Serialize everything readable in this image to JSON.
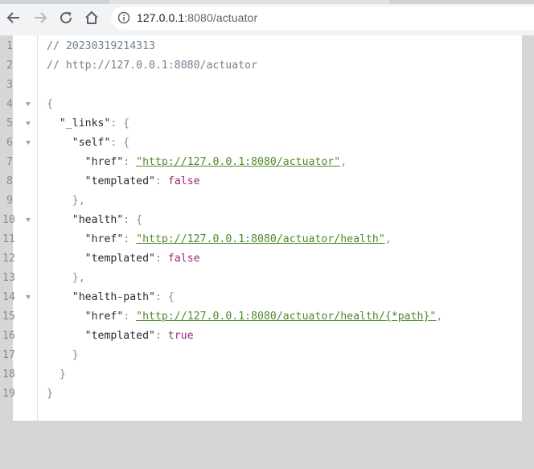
{
  "browser": {
    "url_host": "127.0.0.1",
    "url_path": ":8080/actuator",
    "icons": [
      "back-arrow-icon",
      "forward-arrow-icon",
      "reload-icon",
      "home-icon",
      "info-icon"
    ]
  },
  "code_lines": [
    {
      "num": "1",
      "fold": false,
      "indent": "",
      "tokens": [
        {
          "t": "// 20230319214313",
          "c": "comment"
        }
      ]
    },
    {
      "num": "2",
      "fold": false,
      "indent": "",
      "tokens": [
        {
          "t": "// http://127.0.0.1:8080/actuator",
          "c": "comment"
        }
      ]
    },
    {
      "num": "3",
      "fold": false,
      "indent": "",
      "tokens": []
    },
    {
      "num": "4",
      "fold": true,
      "indent": "",
      "tokens": [
        {
          "t": "{",
          "c": "punc"
        }
      ]
    },
    {
      "num": "5",
      "fold": true,
      "indent": "  ",
      "tokens": [
        {
          "t": "\"_links\"",
          "c": "key"
        },
        {
          "t": ": {",
          "c": "punc"
        }
      ]
    },
    {
      "num": "6",
      "fold": true,
      "indent": "    ",
      "tokens": [
        {
          "t": "\"self\"",
          "c": "key"
        },
        {
          "t": ": {",
          "c": "punc"
        }
      ]
    },
    {
      "num": "7",
      "fold": false,
      "indent": "      ",
      "tokens": [
        {
          "t": "\"href\"",
          "c": "key"
        },
        {
          "t": ": ",
          "c": "punc"
        },
        {
          "t": "\"http://127.0.0.1:8080/actuator\"",
          "c": "link"
        },
        {
          "t": ",",
          "c": "punc"
        }
      ]
    },
    {
      "num": "8",
      "fold": false,
      "indent": "      ",
      "tokens": [
        {
          "t": "\"templated\"",
          "c": "key"
        },
        {
          "t": ": ",
          "c": "punc"
        },
        {
          "t": "false",
          "c": "bool"
        }
      ]
    },
    {
      "num": "9",
      "fold": false,
      "indent": "    ",
      "tokens": [
        {
          "t": "},",
          "c": "punc"
        }
      ]
    },
    {
      "num": "10",
      "fold": true,
      "indent": "    ",
      "tokens": [
        {
          "t": "\"health\"",
          "c": "key"
        },
        {
          "t": ": {",
          "c": "punc"
        }
      ]
    },
    {
      "num": "11",
      "fold": false,
      "indent": "      ",
      "tokens": [
        {
          "t": "\"href\"",
          "c": "key"
        },
        {
          "t": ": ",
          "c": "punc"
        },
        {
          "t": "\"http://127.0.0.1:8080/actuator/health\"",
          "c": "link"
        },
        {
          "t": ",",
          "c": "punc"
        }
      ]
    },
    {
      "num": "12",
      "fold": false,
      "indent": "      ",
      "tokens": [
        {
          "t": "\"templated\"",
          "c": "key"
        },
        {
          "t": ": ",
          "c": "punc"
        },
        {
          "t": "false",
          "c": "bool"
        }
      ]
    },
    {
      "num": "13",
      "fold": false,
      "indent": "    ",
      "tokens": [
        {
          "t": "},",
          "c": "punc"
        }
      ]
    },
    {
      "num": "14",
      "fold": true,
      "indent": "    ",
      "tokens": [
        {
          "t": "\"health-path\"",
          "c": "key"
        },
        {
          "t": ": {",
          "c": "punc"
        }
      ]
    },
    {
      "num": "15",
      "fold": false,
      "indent": "      ",
      "tokens": [
        {
          "t": "\"href\"",
          "c": "key"
        },
        {
          "t": ": ",
          "c": "punc"
        },
        {
          "t": "\"http://127.0.0.1:8080/actuator/health/{*path}\"",
          "c": "link"
        },
        {
          "t": ",",
          "c": "punc"
        }
      ]
    },
    {
      "num": "16",
      "fold": false,
      "indent": "      ",
      "tokens": [
        {
          "t": "\"templated\"",
          "c": "key"
        },
        {
          "t": ": ",
          "c": "punc"
        },
        {
          "t": "true",
          "c": "bool"
        }
      ]
    },
    {
      "num": "17",
      "fold": false,
      "indent": "    ",
      "tokens": [
        {
          "t": "}",
          "c": "punc"
        }
      ]
    },
    {
      "num": "18",
      "fold": false,
      "indent": "  ",
      "tokens": [
        {
          "t": "}",
          "c": "punc"
        }
      ]
    },
    {
      "num": "19",
      "fold": false,
      "indent": "",
      "tokens": [
        {
          "t": "}",
          "c": "punc"
        }
      ]
    }
  ],
  "colors": {
    "comment": "#708090",
    "link": "#4e8a2a",
    "boolean": "#9a2a7a",
    "key": "#2b2b2b",
    "punctuation": "#8a8a8a"
  }
}
